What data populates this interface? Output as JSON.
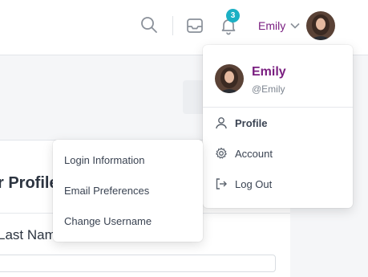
{
  "header": {
    "notifications_count": "3",
    "user_name": "Emily"
  },
  "user_menu": {
    "name": "Emily",
    "handle": "@Emily",
    "items": [
      {
        "label": "Profile",
        "icon": "user-icon"
      },
      {
        "label": "Account",
        "icon": "gear-icon"
      },
      {
        "label": "Log Out",
        "icon": "logout-icon"
      }
    ]
  },
  "account_submenu": {
    "items": [
      "Login Information",
      "Email Preferences",
      "Change Username"
    ]
  },
  "page": {
    "section_title": "r Profile",
    "field_label": "Last Nam"
  },
  "colors": {
    "accent": "#7a1f80",
    "badge": "#1cb0c4",
    "text": "#3a4352"
  }
}
